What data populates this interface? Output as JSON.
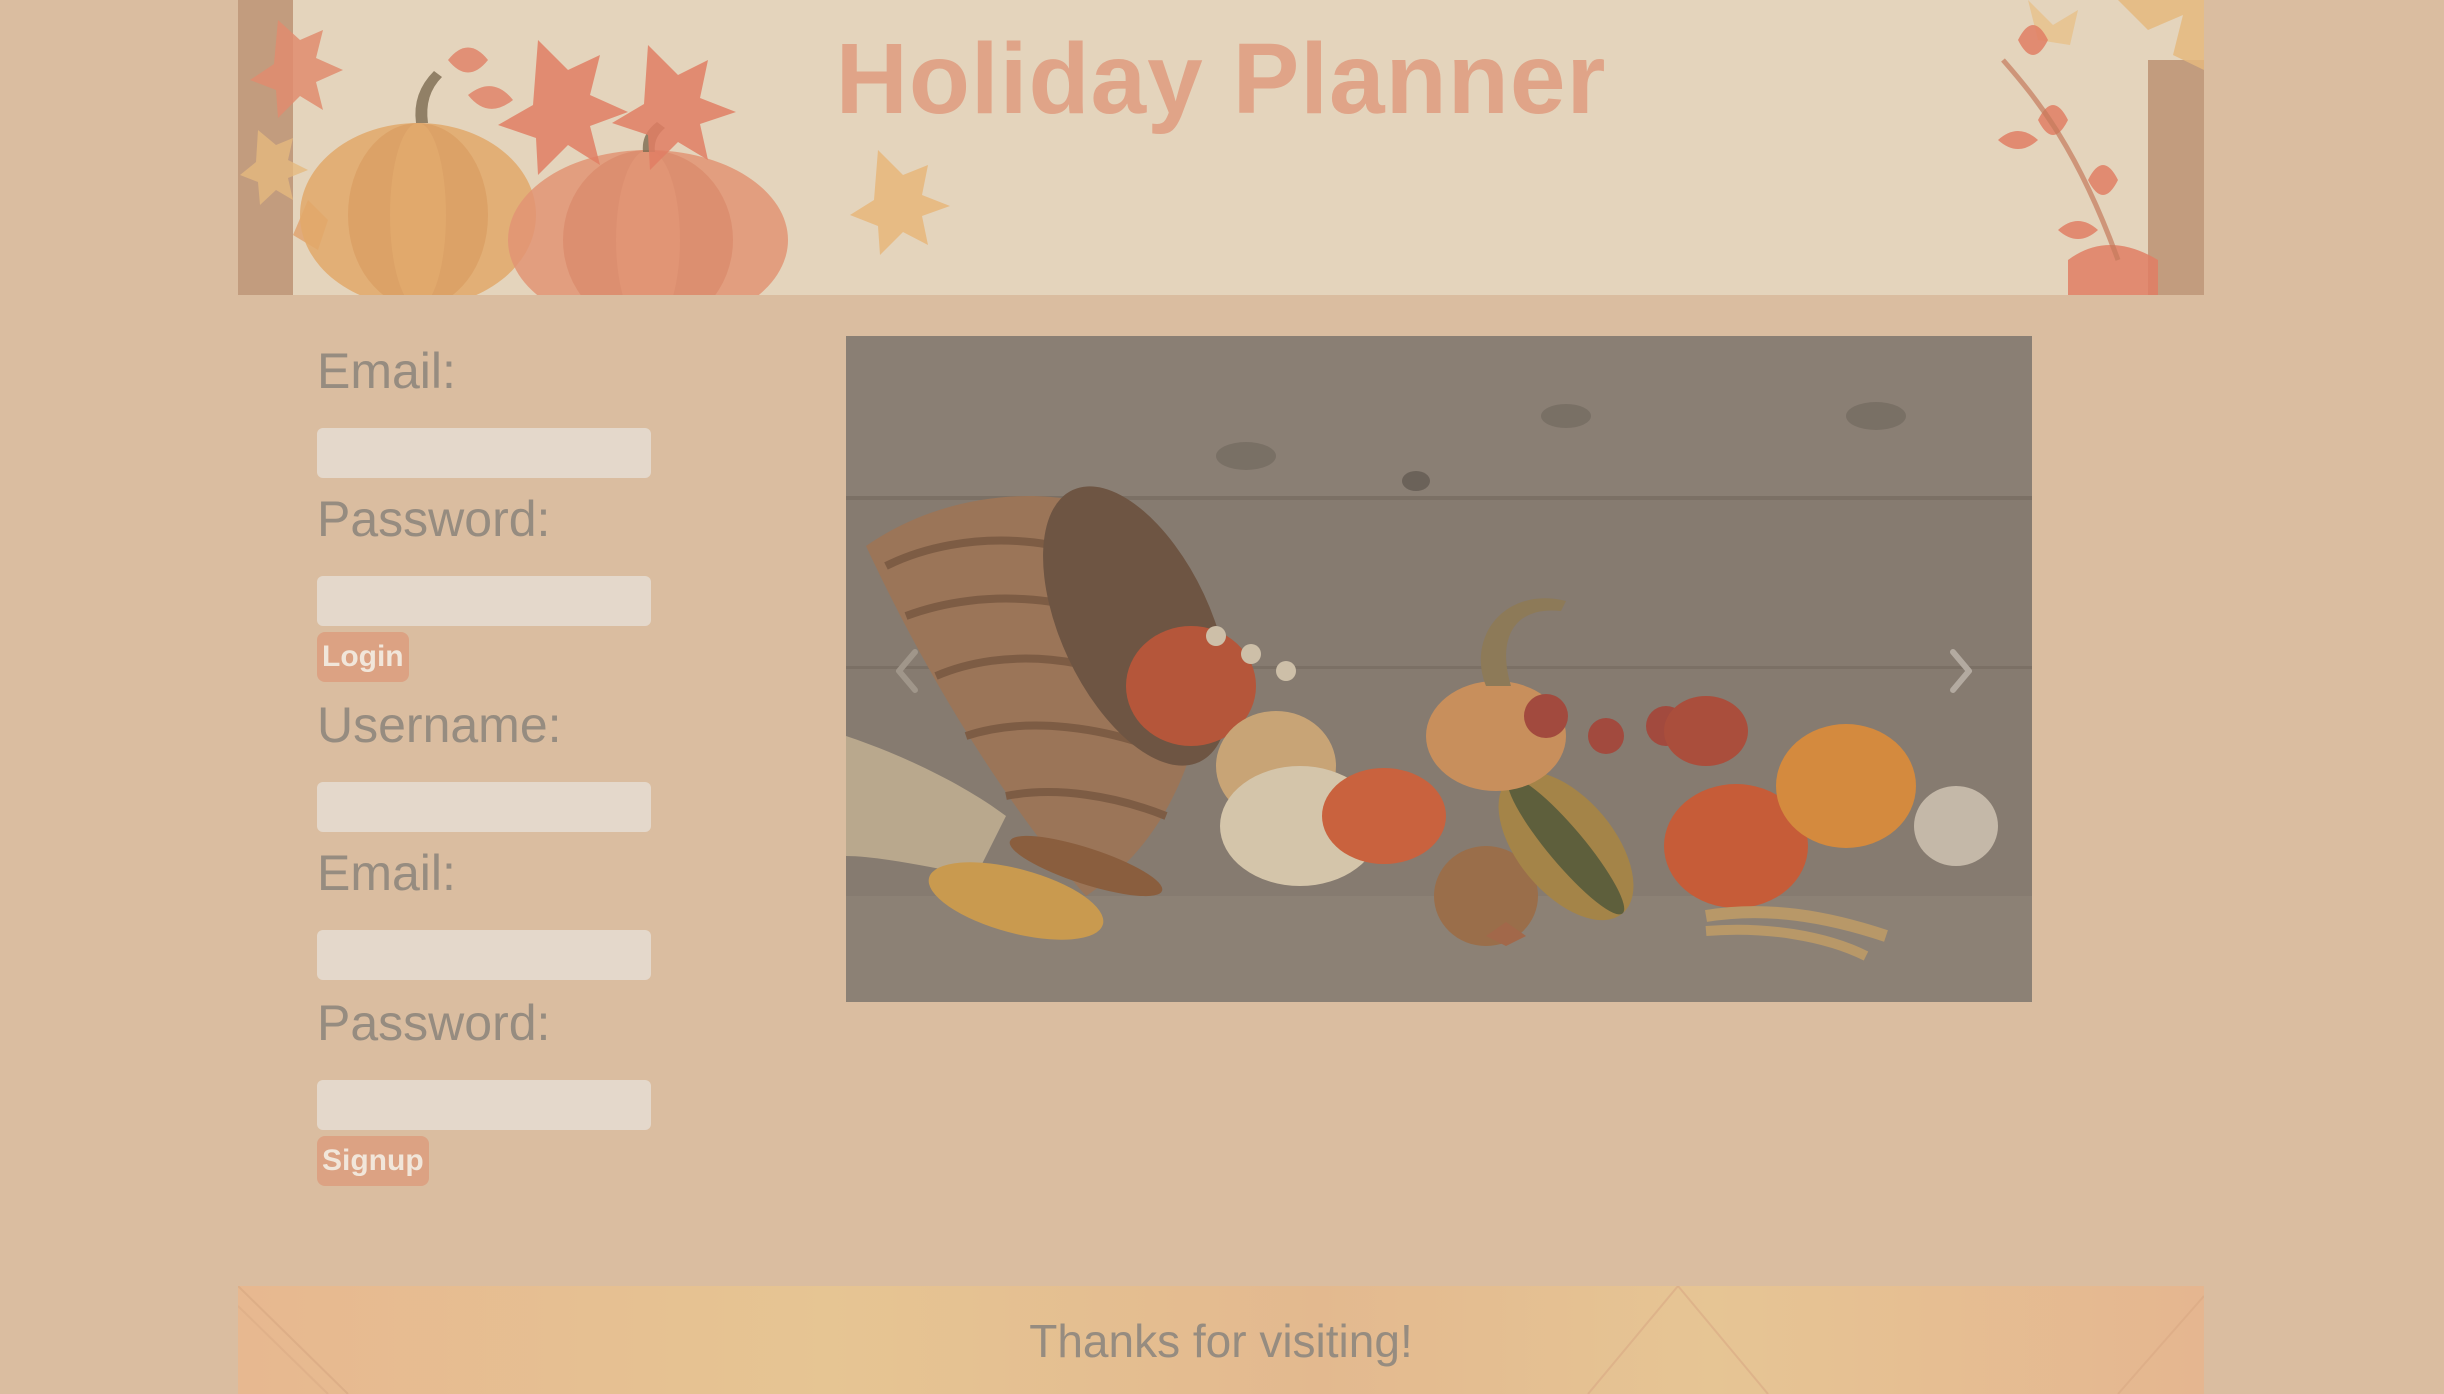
{
  "header": {
    "title": "Holiday Planner"
  },
  "login_form": {
    "email_label": "Email:",
    "email_value": "",
    "password_label": "Password:",
    "password_value": "",
    "submit_label": "Login"
  },
  "signup_form": {
    "username_label": "Username:",
    "username_value": "",
    "email_label": "Email:",
    "email_value": "",
    "password_label": "Password:",
    "password_value": "",
    "submit_label": "Signup"
  },
  "carousel": {
    "prev_icon": "chevron-left-icon",
    "next_icon": "chevron-right-icon",
    "image_subject": "cornucopia-harvest"
  },
  "footer": {
    "text": "Thanks for visiting!"
  },
  "colors": {
    "page_background": "#dabda0",
    "title": "#e0a488",
    "button": "#dca283",
    "label": "#968c80",
    "input": "#e4d8cb"
  }
}
